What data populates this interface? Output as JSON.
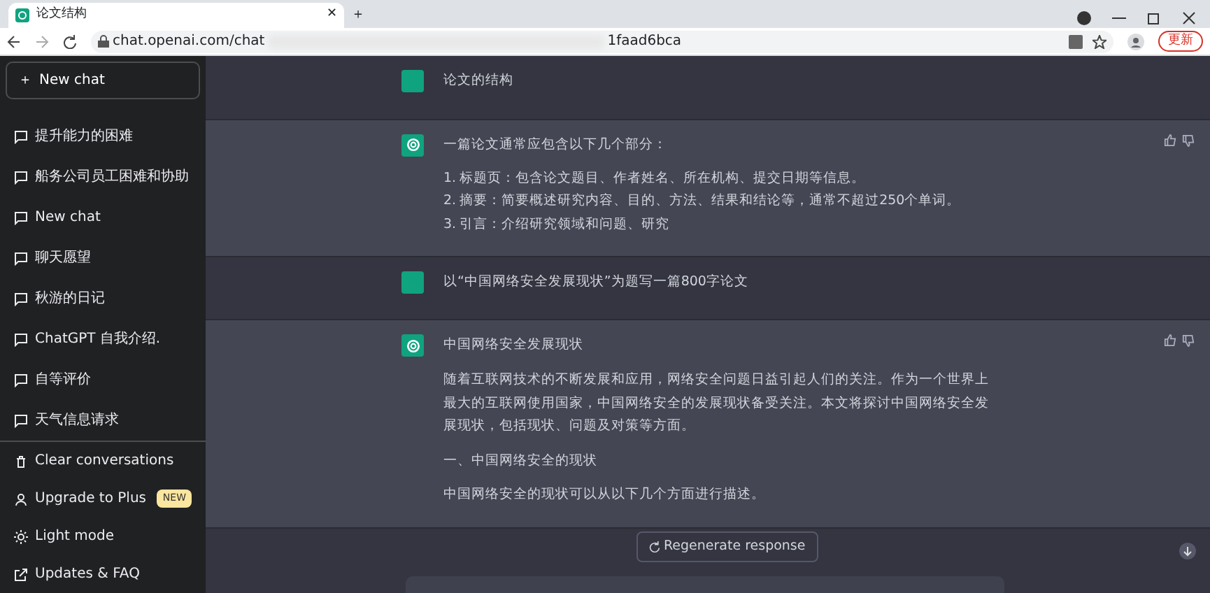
{
  "browser": {
    "tab_title": "论文结构",
    "close_tab": "✕",
    "new_tab": "＋",
    "url_start": "chat.openai.com/chat",
    "url_end": "1faad6bca",
    "update_label": "更新"
  },
  "sidebar": {
    "new_chat_plus": "＋",
    "new_chat": "New chat",
    "history": [
      "提升能力的困难",
      "船务公司员工困难和协助",
      "New chat",
      "聊天愿望",
      "秋游的日记",
      "ChatGPT 自我介绍.",
      "自等评价",
      "天气信息请求"
    ],
    "actions": [
      {
        "kind": "clear",
        "label": "Clear conversations"
      },
      {
        "kind": "upgrade",
        "label": "Upgrade to Plus",
        "badge": "NEW"
      },
      {
        "kind": "light",
        "label": "Light mode"
      },
      {
        "kind": "updates",
        "label": "Updates & FAQ"
      }
    ]
  },
  "messages": [
    {
      "kind": "user",
      "paragraphs": [
        {
          "kind": "text",
          "text": "论文的结构"
        }
      ]
    },
    {
      "kind": "assistant",
      "paragraphs": [
        {
          "kind": "text",
          "text": "一篇论文通常应包含以下几个部分："
        },
        {
          "kind": "list",
          "items": [
            {
              "number": "1.",
              "text": "标题页：包含论文题目、作者姓名、所在机构、提交日期等信息。"
            },
            {
              "number": "2.",
              "text": "摘要：简要概述研究内容、目的、方法、结果和结论等，通常不超过250个单词。"
            },
            {
              "number": "3.",
              "text": "引言：介绍研究领域和问题、研究"
            }
          ]
        }
      ]
    },
    {
      "kind": "user",
      "paragraphs": [
        {
          "kind": "text",
          "text": "以“中国网络安全发展现状”为题写一篇800字论文"
        }
      ]
    },
    {
      "kind": "assistant",
      "paragraphs": [
        {
          "kind": "text",
          "text": "中国网络安全发展现状"
        },
        {
          "kind": "text",
          "text": "随着互联网技术的不断发展和应用，网络安全问题日益引起人们的关注。作为一个世界上最大的互联网使用国家，中国网络安全的发展现状备受关注。本文将探讨中国网络安全发展现状，包括现状、问题及对策等方面。"
        },
        {
          "kind": "text",
          "text": "一、中国网络安全的现状"
        },
        {
          "kind": "text",
          "text": "中国网络安全的现状可以从以下几个方面进行描述。"
        }
      ]
    }
  ],
  "regenerate": "Regenerate response"
}
